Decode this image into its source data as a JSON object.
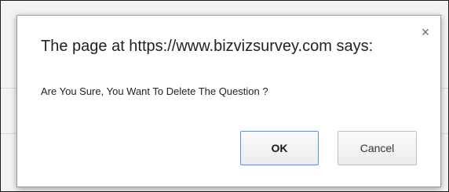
{
  "dialog": {
    "title": "The page at https://www.bizvizsurvey.com says:",
    "message": "Are You Sure, You Want To Delete The Question ?",
    "close_glyph": "×",
    "close_icon": "close-icon",
    "ok_label": "OK",
    "cancel_label": "Cancel"
  },
  "colors": {
    "focus_border": "#4d90fe",
    "text": "#222222"
  }
}
